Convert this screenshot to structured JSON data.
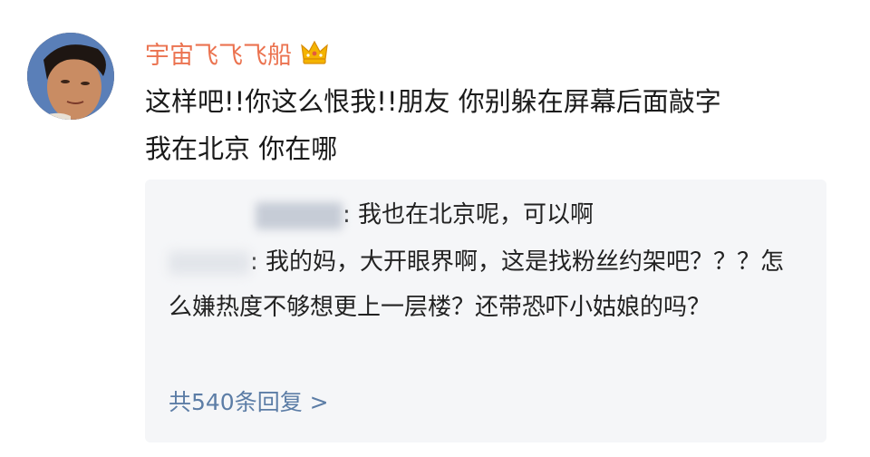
{
  "comment": {
    "username": "宇宙飞飞飞船",
    "badge_icon": "crown-icon",
    "text": "这样吧!!你这么恨我!!朋友 你别躲在屏幕后面敲字\n我在北京 你在哪"
  },
  "replies": [
    {
      "author": "",
      "colon": ":",
      "text": " 我也在北京呢，可以啊"
    },
    {
      "author": "",
      "colon": ":",
      "text": " 我的妈，大开眼界啊，这是找粉丝约架吧？？？怎么嫌热度不够想更上一层楼？还带恐吓小姑娘的吗？"
    }
  ],
  "view_all_replies": "共540条回复 >",
  "colors": {
    "username": "#eb7350",
    "link": "#5c7da6",
    "reply_background": "#f5f6f8"
  }
}
